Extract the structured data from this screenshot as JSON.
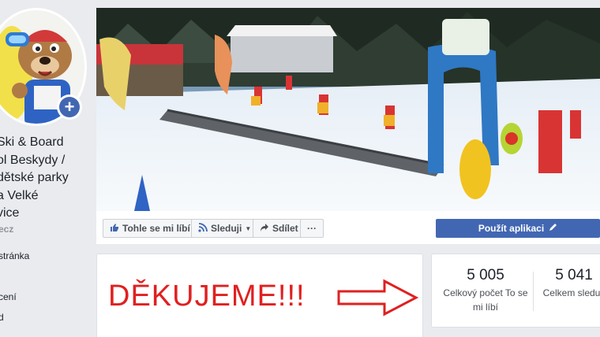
{
  "profile": {
    "name_lines": [
      "Ski & Board",
      "ol Beskydy /",
      "dětské parky",
      "a Velké",
      "vice"
    ],
    "handle": "ecz",
    "add_icon": "+"
  },
  "nav": {
    "items": [
      "stránka",
      "cení",
      "d"
    ]
  },
  "actions": {
    "like_label": "Tohle se mi líbí",
    "follow_label": "Sleduji",
    "share_label": "Sdílet",
    "more_label": "···",
    "primary_label": "Použít aplikaci",
    "like_icon": "thumbs-up-icon",
    "follow_icon": "rss-icon",
    "share_icon": "share-arrow-icon",
    "primary_icon": "pencil-icon"
  },
  "post": {
    "text": "DĚKUJEME!!!"
  },
  "stats": [
    {
      "value": "5 005",
      "label_lines": [
        "Celkový počet To se",
        "mi líbí"
      ]
    },
    {
      "value": "5 041",
      "label_lines": [
        "Celkem sledují"
      ]
    }
  ],
  "colors": {
    "brand_blue": "#4267b2",
    "thanks_red": "#e02020"
  }
}
